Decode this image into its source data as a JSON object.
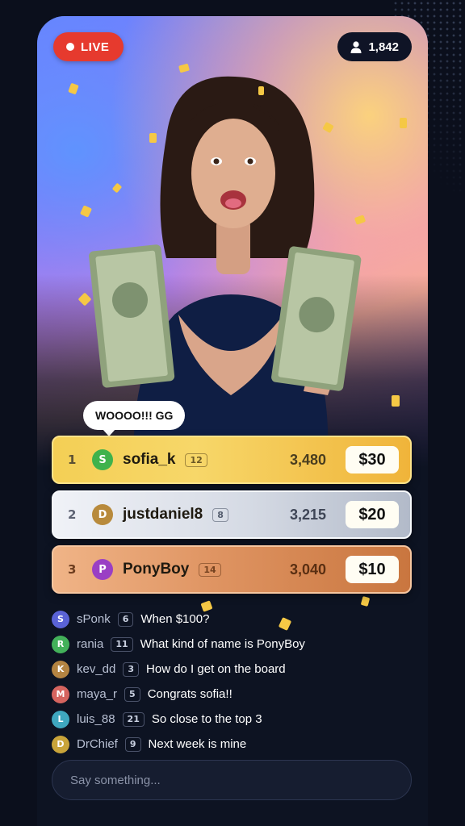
{
  "stream": {
    "live_label": "LIVE",
    "viewer_count": "1,842",
    "speech_bubble": "WOOOO!!! GG"
  },
  "leaderboard": [
    {
      "rank": "1",
      "initial": "S",
      "name": "sofia_k",
      "level": "12",
      "score": "3,480",
      "prize": "$30",
      "avatar_color": "#3fb24c"
    },
    {
      "rank": "2",
      "initial": "D",
      "name": "justdaniel8",
      "level": "8",
      "score": "3,215",
      "prize": "$20",
      "avatar_color": "#b88a3c"
    },
    {
      "rank": "3",
      "initial": "P",
      "name": "PonyBoy",
      "level": "14",
      "score": "3,040",
      "prize": "$10",
      "avatar_color": "#9a3fc4"
    }
  ],
  "chat": [
    {
      "initial": "S",
      "user": "sPonk",
      "level": "6",
      "message": "When $100?",
      "avatar_color": "#5a63d6"
    },
    {
      "initial": "R",
      "user": "rania",
      "level": "11",
      "message": "What kind of name is PonyBoy",
      "avatar_color": "#43b15a"
    },
    {
      "initial": "K",
      "user": "kev_dd",
      "level": "3",
      "message": "How do I get on the board",
      "avatar_color": "#b48442"
    },
    {
      "initial": "M",
      "user": "maya_r",
      "level": "5",
      "message": "Congrats sofia!!",
      "avatar_color": "#d5645f"
    },
    {
      "initial": "L",
      "user": "luis_88",
      "level": "21",
      "message": "So close to the top 3",
      "avatar_color": "#3fa7bf"
    },
    {
      "initial": "D",
      "user": "DrChief",
      "level": "9",
      "message": "Next week is mine",
      "avatar_color": "#c9a43a"
    }
  ],
  "input": {
    "placeholder": "Say something..."
  }
}
